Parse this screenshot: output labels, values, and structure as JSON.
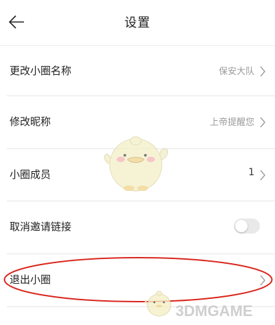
{
  "header": {
    "title": "设置"
  },
  "rows": [
    {
      "label": "更改小圈名称",
      "value": "保安大队"
    },
    {
      "label": "修改昵称",
      "value": "上帝提醒您"
    },
    {
      "label": "小圈成员",
      "value": "1"
    },
    {
      "label": "取消邀请链接",
      "toggle_on": false
    },
    {
      "label": "退出小圈"
    }
  ],
  "highlight": {
    "color": "#d9261c"
  },
  "watermark": {
    "text": "3DMGAME"
  }
}
